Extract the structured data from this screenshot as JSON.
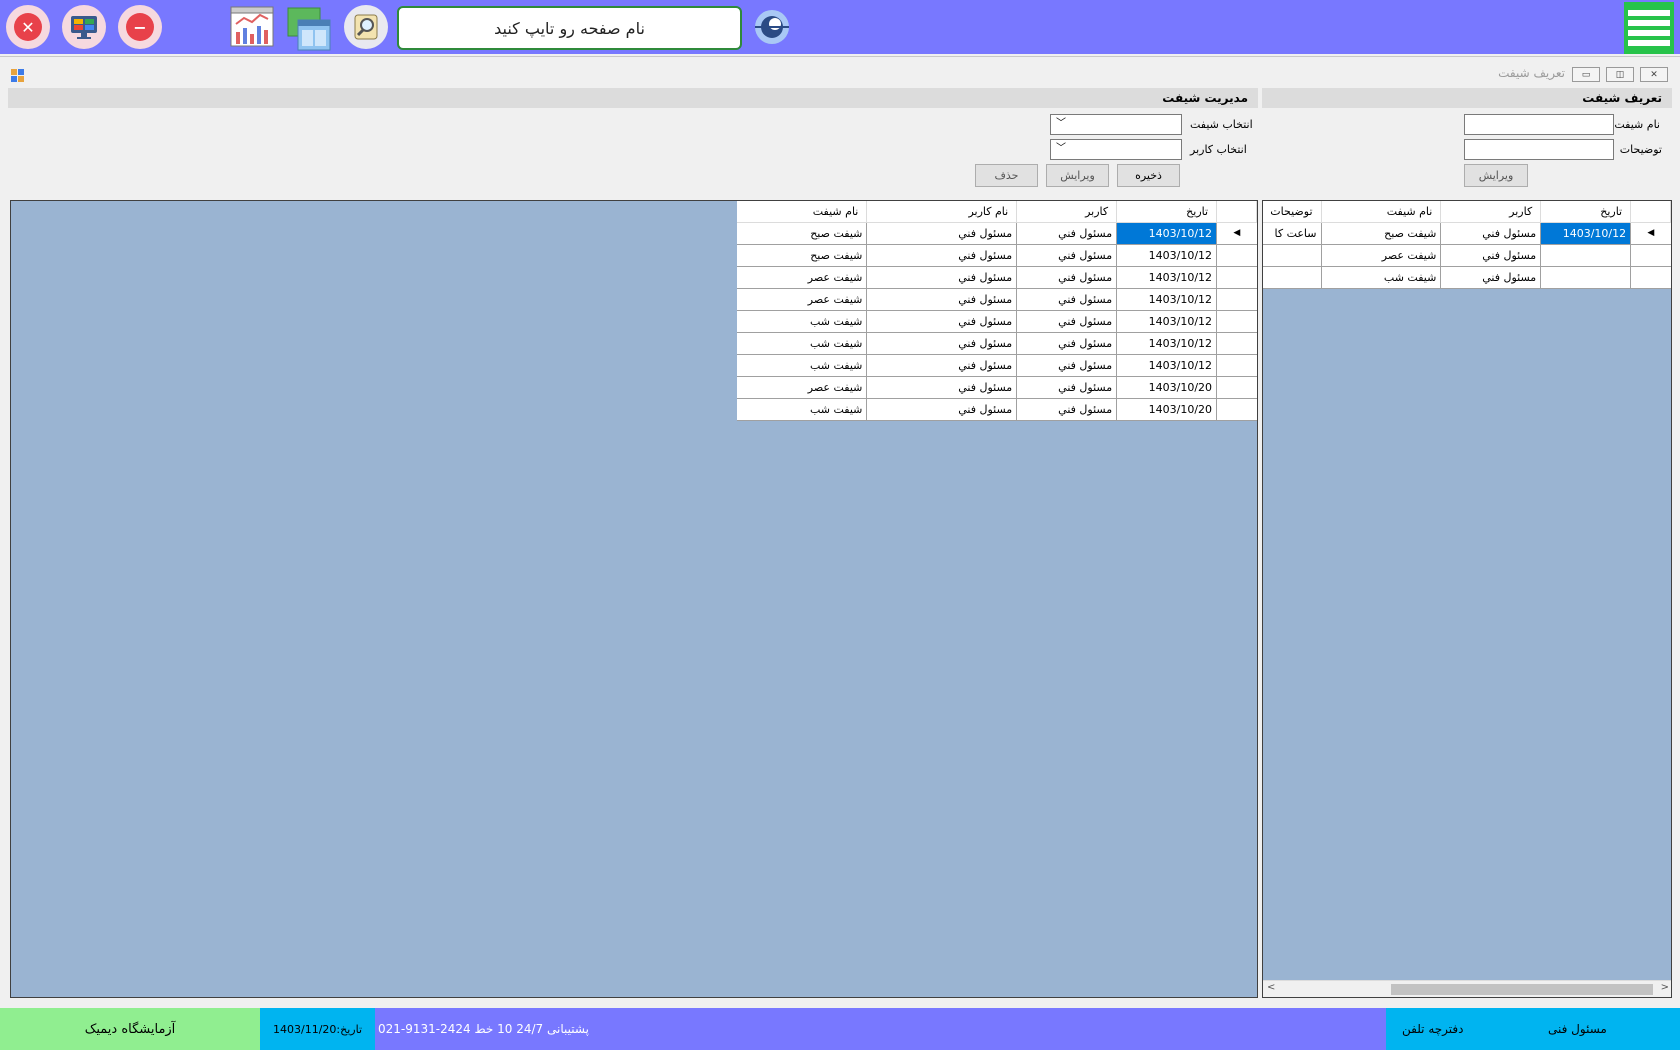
{
  "topbar": {
    "search_placeholder": "نام صفحه رو تایپ کنید"
  },
  "window": {
    "title": "تعریف شیفت"
  },
  "define_panel": {
    "header": "تعریف شیفت",
    "shift_name_label": "نام شیفت",
    "description_label": "توضیحات",
    "edit_button": "ویرایش",
    "grid": {
      "columns": [
        "تاریخ",
        "کاربر",
        "نام شیفت",
        "توضیحات"
      ],
      "rows": [
        [
          "1403/10/12",
          "مسئول فني",
          "شیفت صبح",
          "ساعت کا"
        ],
        [
          "",
          "مسئول فني",
          "شیفت عصر",
          ""
        ],
        [
          "",
          "مسئول فني",
          "شیفت شب",
          ""
        ]
      ]
    }
  },
  "manage_panel": {
    "header": "مدیریت شیفت",
    "select_shift_label": "انتخاب شیفت",
    "select_user_label": "انتخاب کاربر",
    "save_button": "ذخیره",
    "edit_button": "ویرایش",
    "delete_button": "حذف",
    "grid": {
      "columns": [
        "تاریخ",
        "کاربر",
        "نام کاربر",
        "نام شیفت"
      ],
      "rows": [
        [
          "1403/10/12",
          "مسئول فني",
          "مسئول فني",
          "شیفت صبح"
        ],
        [
          "1403/10/12",
          "مسئول فني",
          "مسئول فني",
          "شیفت صبح"
        ],
        [
          "1403/10/12",
          "مسئول فني",
          "مسئول فني",
          "شیفت عصر"
        ],
        [
          "1403/10/12",
          "مسئول فني",
          "مسئول فني",
          "شیفت عصر"
        ],
        [
          "1403/10/12",
          "مسئول فني",
          "مسئول فني",
          "شیفت شب"
        ],
        [
          "1403/10/12",
          "مسئول فني",
          "مسئول فني",
          "شیفت شب"
        ],
        [
          "1403/10/12",
          "مسئول فني",
          "مسئول فني",
          "شیفت شب"
        ],
        [
          "1403/10/20",
          "مسئول فني",
          "مسئول فني",
          "شیفت عصر"
        ],
        [
          "1403/10/20",
          "مسئول فني",
          "مسئول فني",
          "شیفت شب"
        ]
      ]
    }
  },
  "statusbar": {
    "lab_name": "آزمایشگاه دیمیک",
    "date": "تاریخ:1403/11/20",
    "support": "پشتیبانی 24/7   10 خط  2424-9131-021",
    "phonebook": "دفترچه تلفن",
    "user": "مسئول فنی"
  },
  "colors": {
    "topbar": "#7878ff",
    "grid_background": "#9ab4d2",
    "selection": "#0078d7",
    "status_green": "#90ee90",
    "status_cyan": "#00b4f0"
  }
}
